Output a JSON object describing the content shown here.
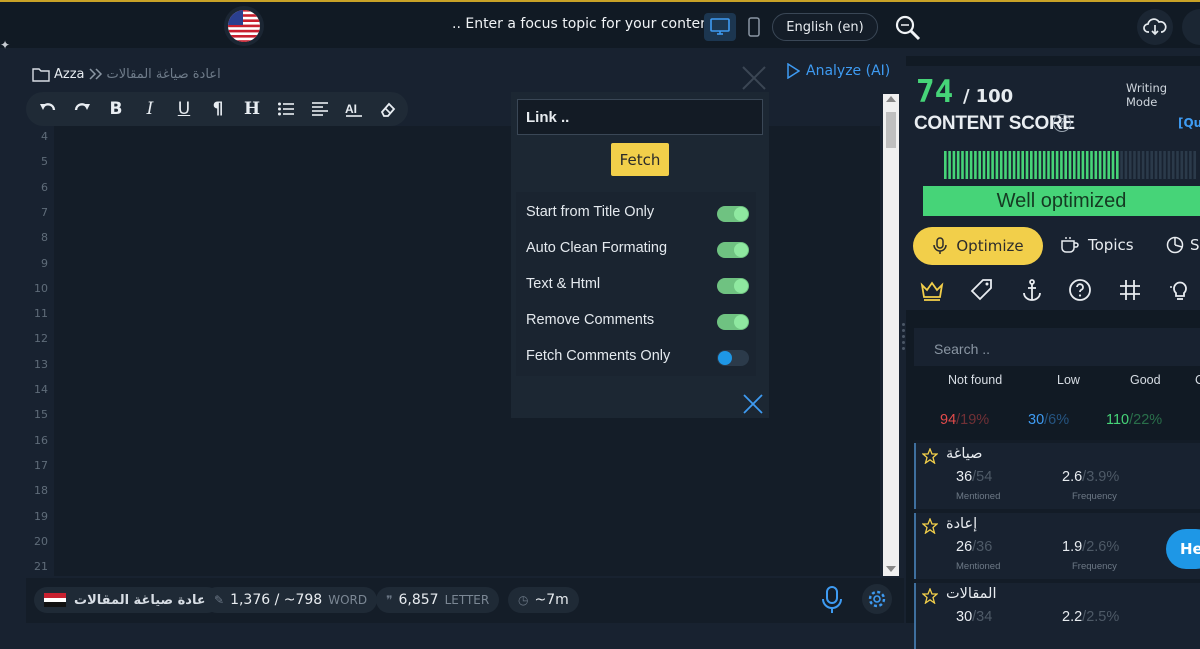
{
  "topbar": {
    "focus_placeholder": ".. Enter a focus topic for your content",
    "language": "English (en)"
  },
  "editor": {
    "breadcrumb_user": "Azza",
    "breadcrumb_doc": "اعادة صياغة المقالات",
    "analyze_label": "Analyze (AI)",
    "line_numbers": [
      "4",
      "5",
      "6",
      "7",
      "8",
      "9",
      "10",
      "11",
      "12",
      "13",
      "14",
      "15",
      "16",
      "17",
      "18",
      "19",
      "20",
      "21"
    ]
  },
  "fetch_panel": {
    "link_placeholder": "Link ..",
    "fetch_label": "Fetch",
    "options": [
      {
        "label": "Start from Title Only",
        "on": true
      },
      {
        "label": "Auto Clean Formating",
        "on": true
      },
      {
        "label": "Text & Html",
        "on": true
      },
      {
        "label": "Remove Comments",
        "on": true
      },
      {
        "label": "Fetch Comments Only",
        "on": false
      }
    ]
  },
  "bottombar": {
    "doc_title": "اعادة صياغة المقالات",
    "words": "1,376 / ~798",
    "words_unit": "WORD",
    "letters": "6,857",
    "letters_unit": "LETTER",
    "time": "~7m"
  },
  "score": {
    "value": "74",
    "slash": "/",
    "max": "100",
    "label": "CONTENT SCORE",
    "writing_mode": "Writing Mode",
    "quick_link": "[Quic",
    "status": "Well optimized",
    "meter_level": 0.74,
    "colors": {
      "good": "#46d478",
      "accent": "#f2cf4a",
      "link": "#3e9bf2"
    }
  },
  "tabs": {
    "optimize": "Optimize",
    "topics": "Topics",
    "third": "S"
  },
  "keywords": {
    "search_placeholder": "Search ..",
    "columns": [
      "Not found",
      "Low",
      "Good",
      "C"
    ],
    "counts": [
      {
        "value": "94",
        "pct": "/19%",
        "color": "#e34b4b"
      },
      {
        "value": "30",
        "pct": "/6%",
        "color": "#3e9bf2"
      },
      {
        "value": "110",
        "pct": "/22%",
        "color": "#46d478"
      }
    ],
    "items": [
      {
        "name": "صياغة",
        "mentioned": "36",
        "mentioned_of": "/54",
        "mentioned_label": "Mentioned",
        "freq": "2.6",
        "freq_of": "/3.9%",
        "freq_label": "Frequency"
      },
      {
        "name": "إعادة",
        "mentioned": "26",
        "mentioned_of": "/36",
        "mentioned_label": "Mentioned",
        "freq": "1.9",
        "freq_of": "/2.6%",
        "freq_label": "Frequency"
      },
      {
        "name": "المقالات",
        "mentioned": "30",
        "mentioned_of": "/34",
        "mentioned_label": "",
        "freq": "2.2",
        "freq_of": "/2.5%",
        "freq_label": ""
      }
    ],
    "help_bubble": "He"
  }
}
